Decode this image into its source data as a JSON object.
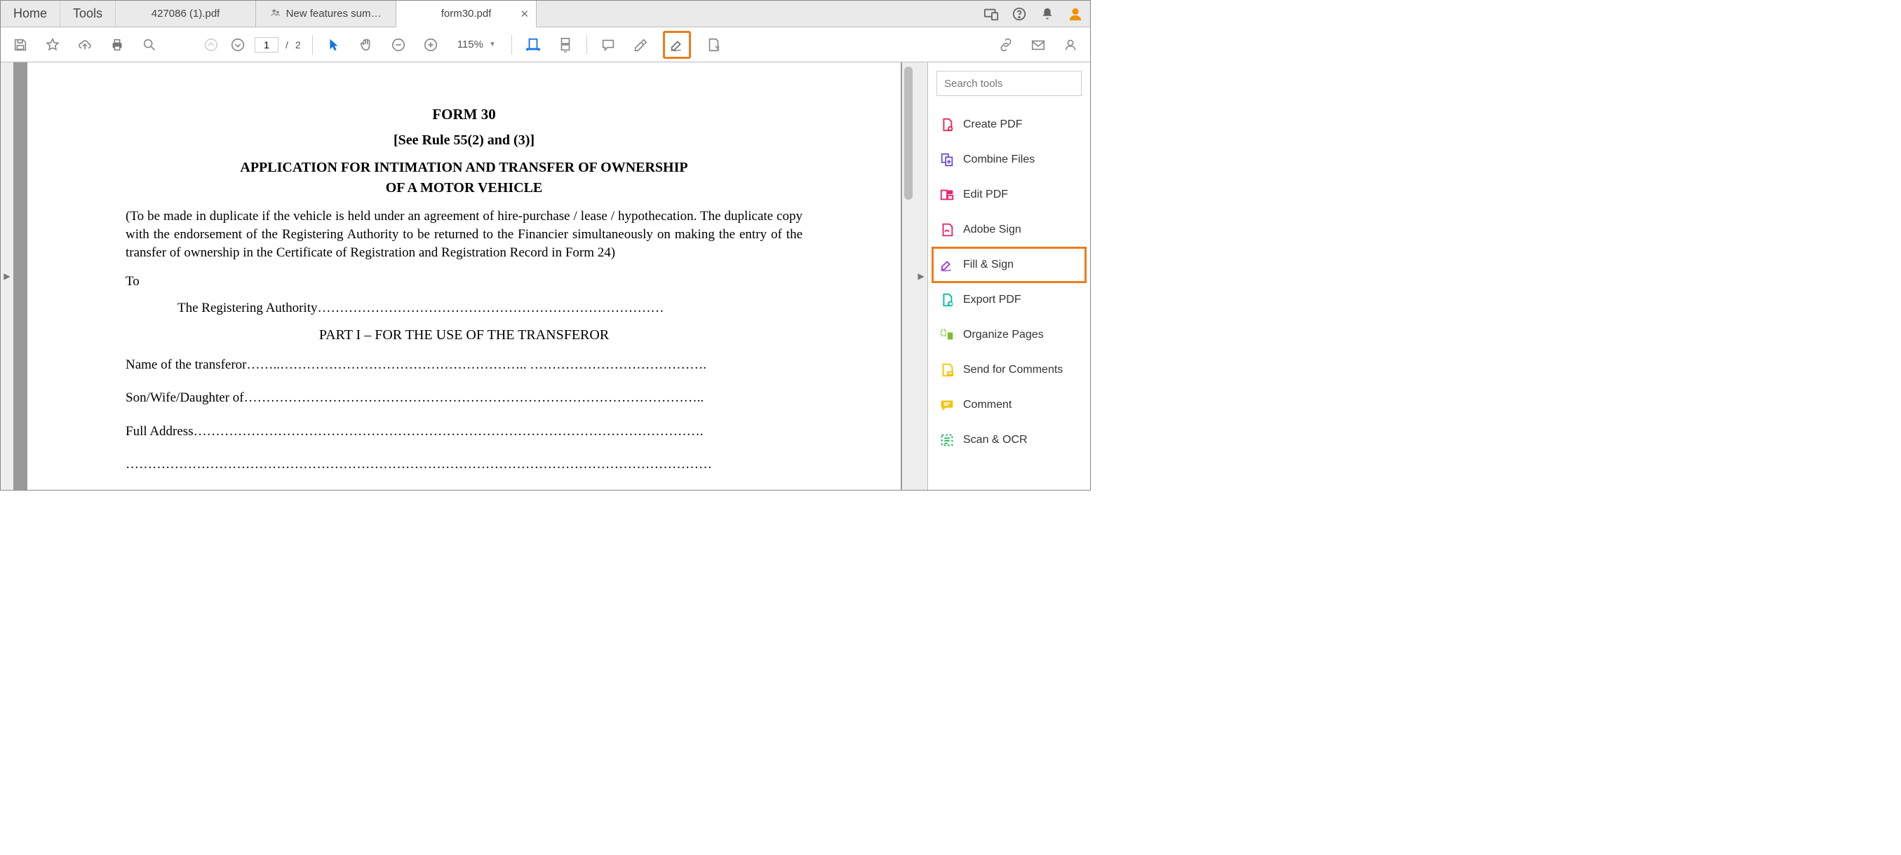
{
  "tabs": {
    "home": "Home",
    "tools": "Tools",
    "docs": [
      {
        "label": "427086 (1).pdf",
        "active": false,
        "close": false
      },
      {
        "label": "New features sum…",
        "active": false,
        "close": false,
        "shared": true
      },
      {
        "label": "form30.pdf",
        "active": true,
        "close": true
      }
    ]
  },
  "toolbar": {
    "page_current": "1",
    "page_sep": "/",
    "page_total": "2",
    "zoom": "115%"
  },
  "document": {
    "title1": "FORM 30",
    "title2": "[See Rule 55(2) and (3)]",
    "title3a": "APPLICATION FOR INTIMATION AND TRANSFER OF OWNERSHIP",
    "title3b": "OF A MOTOR VEHICLE",
    "note": "(To be made in duplicate if the vehicle is held under an agreement of hire-purchase / lease / hypothecation. The duplicate copy with the endorsement of the Registering Authority to be returned to the Financier simultaneously on making the entry of the transfer of ownership in the Certificate of Registration and Registration Record in Form 24)",
    "to": "To",
    "reg_authority": "The Registering Authority……………………………………………………………………",
    "part1": "PART I – FOR THE USE OF THE TRANSFEROR",
    "line_name": "Name of the transferor……..……………………………………………….. ………………………………….",
    "line_swd": "Son/Wife/Daughter of…………………………………………………………………………………………..",
    "line_addr": "Full Address…………………………………………………………………………………………………….",
    "line_blank": "……………………………………………………………………………………………………………………"
  },
  "right_panel": {
    "search_placeholder": "Search tools",
    "tools": [
      {
        "label": "Create PDF",
        "color": "#e6204b"
      },
      {
        "label": "Combine Files",
        "color": "#6b4ed6"
      },
      {
        "label": "Edit PDF",
        "color": "#e6206e"
      },
      {
        "label": "Adobe Sign",
        "color": "#e6206e"
      },
      {
        "label": "Fill & Sign",
        "color": "#9b3bd4",
        "highlight": true
      },
      {
        "label": "Export PDF",
        "color": "#00b8a3"
      },
      {
        "label": "Organize Pages",
        "color": "#7bbf2e"
      },
      {
        "label": "Send for Comments",
        "color": "#f2c200"
      },
      {
        "label": "Comment",
        "color": "#f2c200"
      },
      {
        "label": "Scan & OCR",
        "color": "#2fb866"
      }
    ]
  }
}
